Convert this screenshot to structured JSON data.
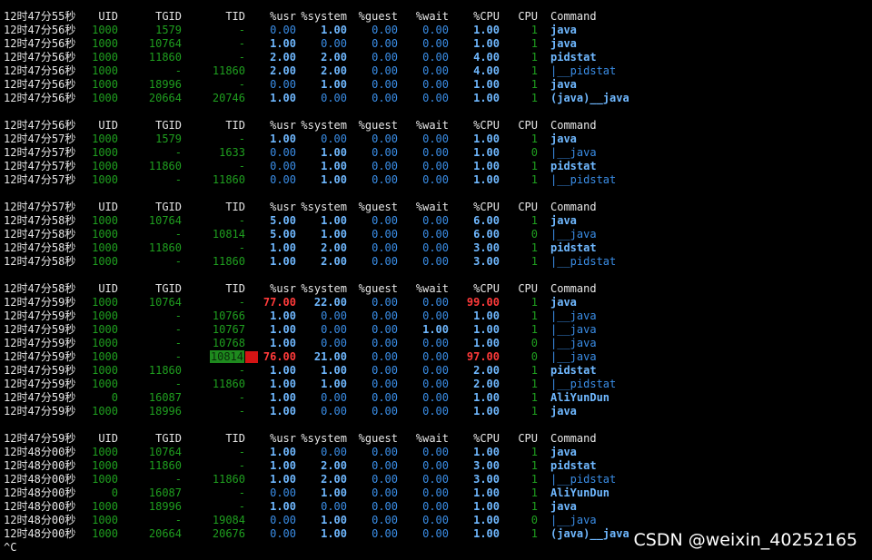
{
  "colors": {
    "background": "#000000",
    "header_text": "#e6e6e6",
    "id_green": "#1f9f1f",
    "value_blue": "#3a8de6",
    "value_bright": "#6fb8ff",
    "alert_red": "#ff3a3a",
    "highlight_green_bg": "#1e8a1e",
    "highlight_red_block": "#d41414"
  },
  "blocks": [
    {
      "header": {
        "time": "12时47分55秒",
        "uid": "UID",
        "tgid": "TGID",
        "tid": "TID",
        "usr": "%usr",
        "system": "%system",
        "guest": "%guest",
        "wait": "%wait",
        "cpu_pct": "%CPU",
        "cpu": "CPU",
        "command": "Command"
      },
      "rows": [
        {
          "time": "12时47分56秒",
          "uid": "1000",
          "tgid": "1579",
          "tid": "-",
          "usr": "0.00",
          "system": "1.00",
          "guest": "0.00",
          "wait": "0.00",
          "cpu_pct": "1.00",
          "cpu": "1",
          "command": "java"
        },
        {
          "time": "12时47分56秒",
          "uid": "1000",
          "tgid": "10764",
          "tid": "-",
          "usr": "1.00",
          "system": "0.00",
          "guest": "0.00",
          "wait": "0.00",
          "cpu_pct": "1.00",
          "cpu": "1",
          "command": "java"
        },
        {
          "time": "12时47分56秒",
          "uid": "1000",
          "tgid": "11860",
          "tid": "-",
          "usr": "2.00",
          "system": "2.00",
          "guest": "0.00",
          "wait": "0.00",
          "cpu_pct": "4.00",
          "cpu": "1",
          "command": "pidstat"
        },
        {
          "time": "12时47分56秒",
          "uid": "1000",
          "tgid": "-",
          "tid": "11860",
          "usr": "2.00",
          "system": "2.00",
          "guest": "0.00",
          "wait": "0.00",
          "cpu_pct": "4.00",
          "cpu": "1",
          "command": "|__pidstat"
        },
        {
          "time": "12时47分56秒",
          "uid": "1000",
          "tgid": "18996",
          "tid": "-",
          "usr": "0.00",
          "system": "1.00",
          "guest": "0.00",
          "wait": "0.00",
          "cpu_pct": "1.00",
          "cpu": "1",
          "command": "java"
        },
        {
          "time": "12时47分56秒",
          "uid": "1000",
          "tgid": "20664",
          "tid": "20746",
          "usr": "1.00",
          "system": "0.00",
          "guest": "0.00",
          "wait": "0.00",
          "cpu_pct": "1.00",
          "cpu": "1",
          "command": "(java)__java"
        }
      ]
    },
    {
      "header": {
        "time": "12时47分56秒",
        "uid": "UID",
        "tgid": "TGID",
        "tid": "TID",
        "usr": "%usr",
        "system": "%system",
        "guest": "%guest",
        "wait": "%wait",
        "cpu_pct": "%CPU",
        "cpu": "CPU",
        "command": "Command"
      },
      "rows": [
        {
          "time": "12时47分57秒",
          "uid": "1000",
          "tgid": "1579",
          "tid": "-",
          "usr": "1.00",
          "system": "0.00",
          "guest": "0.00",
          "wait": "0.00",
          "cpu_pct": "1.00",
          "cpu": "1",
          "command": "java"
        },
        {
          "time": "12时47分57秒",
          "uid": "1000",
          "tgid": "-",
          "tid": "1633",
          "usr": "0.00",
          "system": "1.00",
          "guest": "0.00",
          "wait": "0.00",
          "cpu_pct": "1.00",
          "cpu": "0",
          "command": "|__java"
        },
        {
          "time": "12时47分57秒",
          "uid": "1000",
          "tgid": "11860",
          "tid": "-",
          "usr": "0.00",
          "system": "1.00",
          "guest": "0.00",
          "wait": "0.00",
          "cpu_pct": "1.00",
          "cpu": "1",
          "command": "pidstat"
        },
        {
          "time": "12时47分57秒",
          "uid": "1000",
          "tgid": "-",
          "tid": "11860",
          "usr": "0.00",
          "system": "1.00",
          "guest": "0.00",
          "wait": "0.00",
          "cpu_pct": "1.00",
          "cpu": "1",
          "command": "|__pidstat"
        }
      ]
    },
    {
      "header": {
        "time": "12时47分57秒",
        "uid": "UID",
        "tgid": "TGID",
        "tid": "TID",
        "usr": "%usr",
        "system": "%system",
        "guest": "%guest",
        "wait": "%wait",
        "cpu_pct": "%CPU",
        "cpu": "CPU",
        "command": "Command"
      },
      "rows": [
        {
          "time": "12时47分58秒",
          "uid": "1000",
          "tgid": "10764",
          "tid": "-",
          "usr": "5.00",
          "system": "1.00",
          "guest": "0.00",
          "wait": "0.00",
          "cpu_pct": "6.00",
          "cpu": "1",
          "command": "java"
        },
        {
          "time": "12时47分58秒",
          "uid": "1000",
          "tgid": "-",
          "tid": "10814",
          "usr": "5.00",
          "system": "1.00",
          "guest": "0.00",
          "wait": "0.00",
          "cpu_pct": "6.00",
          "cpu": "0",
          "command": "|__java"
        },
        {
          "time": "12时47分58秒",
          "uid": "1000",
          "tgid": "11860",
          "tid": "-",
          "usr": "1.00",
          "system": "2.00",
          "guest": "0.00",
          "wait": "0.00",
          "cpu_pct": "3.00",
          "cpu": "1",
          "command": "pidstat"
        },
        {
          "time": "12时47分58秒",
          "uid": "1000",
          "tgid": "-",
          "tid": "11860",
          "usr": "1.00",
          "system": "2.00",
          "guest": "0.00",
          "wait": "0.00",
          "cpu_pct": "3.00",
          "cpu": "1",
          "command": "|__pidstat"
        }
      ]
    },
    {
      "header": {
        "time": "12时47分58秒",
        "uid": "UID",
        "tgid": "TGID",
        "tid": "TID",
        "usr": "%usr",
        "system": "%system",
        "guest": "%guest",
        "wait": "%wait",
        "cpu_pct": "%CPU",
        "cpu": "CPU",
        "command": "Command"
      },
      "rows": [
        {
          "time": "12时47分59秒",
          "uid": "1000",
          "tgid": "10764",
          "tid": "-",
          "usr": "77.00",
          "system": "22.00",
          "guest": "0.00",
          "wait": "0.00",
          "cpu_pct": "99.00",
          "cpu": "1",
          "command": "java",
          "alert": true
        },
        {
          "time": "12时47分59秒",
          "uid": "1000",
          "tgid": "-",
          "tid": "10766",
          "usr": "1.00",
          "system": "0.00",
          "guest": "0.00",
          "wait": "0.00",
          "cpu_pct": "1.00",
          "cpu": "1",
          "command": "|__java"
        },
        {
          "time": "12时47分59秒",
          "uid": "1000",
          "tgid": "-",
          "tid": "10767",
          "usr": "1.00",
          "system": "0.00",
          "guest": "0.00",
          "wait": "1.00",
          "cpu_pct": "1.00",
          "cpu": "1",
          "command": "|__java"
        },
        {
          "time": "12时47分59秒",
          "uid": "1000",
          "tgid": "-",
          "tid": "10768",
          "usr": "1.00",
          "system": "0.00",
          "guest": "0.00",
          "wait": "0.00",
          "cpu_pct": "1.00",
          "cpu": "0",
          "command": "|__java"
        },
        {
          "time": "12时47分59秒",
          "uid": "1000",
          "tgid": "-",
          "tid": "10814",
          "usr": "76.00",
          "system": "21.00",
          "guest": "0.00",
          "wait": "0.00",
          "cpu_pct": "97.00",
          "cpu": "0",
          "command": "|__java",
          "alert": true,
          "highlight_tid": true
        },
        {
          "time": "12时47分59秒",
          "uid": "1000",
          "tgid": "11860",
          "tid": "-",
          "usr": "1.00",
          "system": "1.00",
          "guest": "0.00",
          "wait": "0.00",
          "cpu_pct": "2.00",
          "cpu": "1",
          "command": "pidstat"
        },
        {
          "time": "12时47分59秒",
          "uid": "1000",
          "tgid": "-",
          "tid": "11860",
          "usr": "1.00",
          "system": "1.00",
          "guest": "0.00",
          "wait": "0.00",
          "cpu_pct": "2.00",
          "cpu": "1",
          "command": "|__pidstat"
        },
        {
          "time": "12时47分59秒",
          "uid": "0",
          "tgid": "16087",
          "tid": "-",
          "usr": "1.00",
          "system": "0.00",
          "guest": "0.00",
          "wait": "0.00",
          "cpu_pct": "1.00",
          "cpu": "1",
          "command": "AliYunDun"
        },
        {
          "time": "12时47分59秒",
          "uid": "1000",
          "tgid": "18996",
          "tid": "-",
          "usr": "1.00",
          "system": "0.00",
          "guest": "0.00",
          "wait": "0.00",
          "cpu_pct": "1.00",
          "cpu": "1",
          "command": "java"
        }
      ]
    },
    {
      "header": {
        "time": "12时47分59秒",
        "uid": "UID",
        "tgid": "TGID",
        "tid": "TID",
        "usr": "%usr",
        "system": "%system",
        "guest": "%guest",
        "wait": "%wait",
        "cpu_pct": "%CPU",
        "cpu": "CPU",
        "command": "Command"
      },
      "rows": [
        {
          "time": "12时48分00秒",
          "uid": "1000",
          "tgid": "10764",
          "tid": "-",
          "usr": "1.00",
          "system": "0.00",
          "guest": "0.00",
          "wait": "0.00",
          "cpu_pct": "1.00",
          "cpu": "1",
          "command": "java"
        },
        {
          "time": "12时48分00秒",
          "uid": "1000",
          "tgid": "11860",
          "tid": "-",
          "usr": "1.00",
          "system": "2.00",
          "guest": "0.00",
          "wait": "0.00",
          "cpu_pct": "3.00",
          "cpu": "1",
          "command": "pidstat"
        },
        {
          "time": "12时48分00秒",
          "uid": "1000",
          "tgid": "-",
          "tid": "11860",
          "usr": "1.00",
          "system": "2.00",
          "guest": "0.00",
          "wait": "0.00",
          "cpu_pct": "3.00",
          "cpu": "1",
          "command": "|__pidstat"
        },
        {
          "time": "12时48分00秒",
          "uid": "0",
          "tgid": "16087",
          "tid": "-",
          "usr": "0.00",
          "system": "1.00",
          "guest": "0.00",
          "wait": "0.00",
          "cpu_pct": "1.00",
          "cpu": "1",
          "command": "AliYunDun"
        },
        {
          "time": "12时48分00秒",
          "uid": "1000",
          "tgid": "18996",
          "tid": "-",
          "usr": "1.00",
          "system": "0.00",
          "guest": "0.00",
          "wait": "0.00",
          "cpu_pct": "1.00",
          "cpu": "1",
          "command": "java"
        },
        {
          "time": "12时48分00秒",
          "uid": "1000",
          "tgid": "-",
          "tid": "19084",
          "usr": "0.00",
          "system": "1.00",
          "guest": "0.00",
          "wait": "0.00",
          "cpu_pct": "1.00",
          "cpu": "0",
          "command": "|__java"
        },
        {
          "time": "12时48分00秒",
          "uid": "1000",
          "tgid": "20664",
          "tid": "20676",
          "usr": "0.00",
          "system": "1.00",
          "guest": "0.00",
          "wait": "0.00",
          "cpu_pct": "1.00",
          "cpu": "1",
          "command": "(java)__java"
        }
      ]
    }
  ],
  "prompt": "^C",
  "watermark": "CSDN @weixin_40252165"
}
